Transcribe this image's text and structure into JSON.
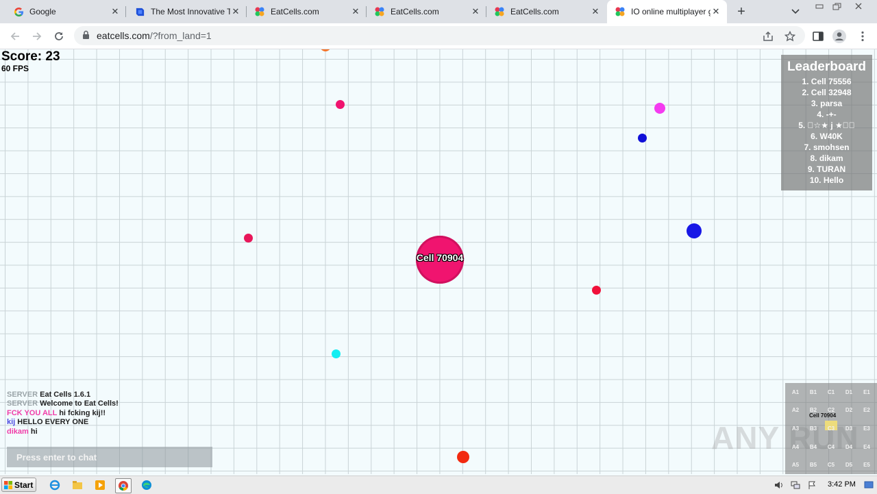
{
  "browser": {
    "tabs": [
      {
        "title": "Google",
        "icon": "google-icon"
      },
      {
        "title": "The Most Innovative Tr",
        "icon": "blue-flag-icon"
      },
      {
        "title": "EatCells.com",
        "icon": "eatcells-icon"
      },
      {
        "title": "EatCells.com",
        "icon": "eatcells-icon"
      },
      {
        "title": "EatCells.com",
        "icon": "eatcells-icon"
      },
      {
        "title": "IO online multiplayer ga",
        "icon": "eatcells-icon",
        "active": true
      }
    ],
    "url_host": "eatcells.com",
    "url_rest": "/?from_land=1"
  },
  "game": {
    "score_text": "Score: 23",
    "fps_text": "60 FPS",
    "player_name": "Cell 70904",
    "player_color": "#f0146f",
    "leaderboard": {
      "title": "Leaderboard",
      "items": [
        "1. Cell 75556",
        "2. Cell 32948",
        "3. parsa",
        "4. -+-",
        "5. ⃝☆★ j ★☆⃝",
        "6. W40K",
        "7. smohsen",
        "8. dikam",
        "9. TURAN",
        "10. Hello"
      ]
    },
    "chat": [
      {
        "who": "SERVER",
        "msg": "Eat Cells 1.6.1"
      },
      {
        "who": "SERVER",
        "msg": "Welcome to Eat Cells!"
      },
      {
        "who": "FCK YOU ALL",
        "msg": "hi fcking kij!!"
      },
      {
        "who": "kij",
        "msg": "HELLO EVERY ONE"
      },
      {
        "who": "dikam",
        "msg": "hi"
      }
    ],
    "chat_placeholder": "Press enter to chat",
    "minimap": {
      "rows": [
        [
          "A1",
          "B1",
          "C1",
          "D1",
          "E1"
        ],
        [
          "A2",
          "B2",
          "C2",
          "D2",
          "E2"
        ],
        [
          "A3",
          "B3",
          "C3",
          "D3",
          "E3"
        ],
        [
          "A4",
          "B4",
          "C4",
          "D4",
          "E4"
        ],
        [
          "A5",
          "B5",
          "C5",
          "D5",
          "E5"
        ]
      ],
      "player_label": "Cell 70904"
    },
    "pellet_colors": [
      "#f5742a",
      "#f0146f",
      "#f43bf0",
      "#1010d8",
      "#e8175a",
      "#1818e6",
      "#f0103a",
      "#13eef2",
      "#f22a10"
    ]
  },
  "watermark": "ANY RUN",
  "taskbar": {
    "start_label": "Start",
    "clock": "3:42 PM"
  }
}
